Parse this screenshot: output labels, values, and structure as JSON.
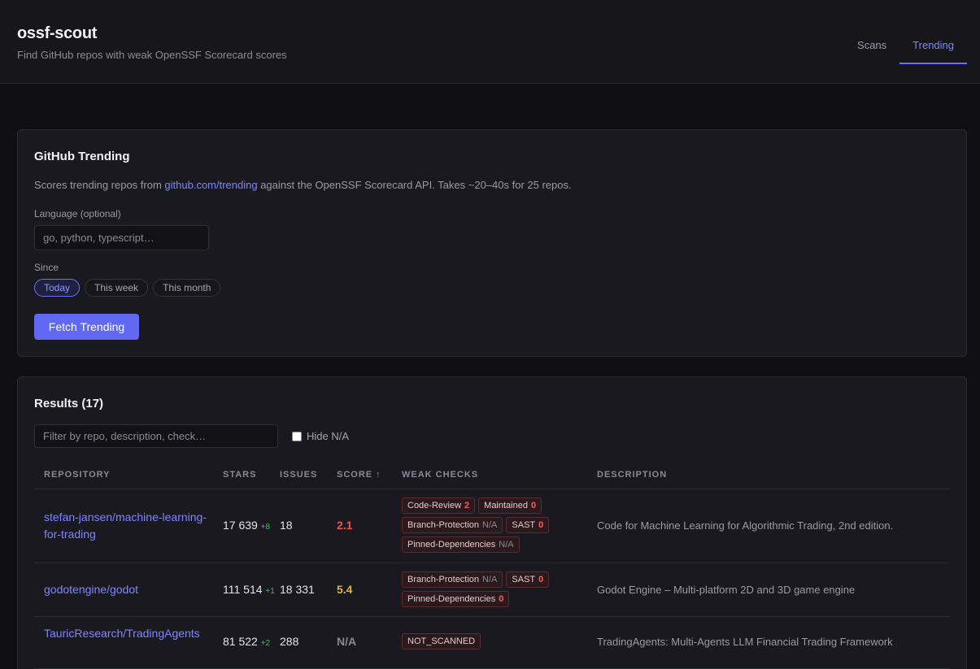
{
  "app": {
    "title": "ossf-scout",
    "subtitle": "Find GitHub repos with weak OpenSSF Scorecard scores"
  },
  "nav": {
    "tabs": [
      {
        "label": "Scans",
        "active": false
      },
      {
        "label": "Trending",
        "active": true
      }
    ]
  },
  "trending": {
    "title": "GitHub Trending",
    "desc_before": "Scores trending repos from ",
    "desc_link": "github.com/trending",
    "desc_after": " against the OpenSSF Scorecard API. Takes ~20–40s for 25 repos.",
    "language_label": "Language (optional)",
    "language_placeholder": "go, python, typescript…",
    "language_value": "",
    "since_label": "Since",
    "since_options": [
      "Today",
      "This week",
      "This month"
    ],
    "since_selected": "Today",
    "fetch_label": "Fetch Trending"
  },
  "results": {
    "title": "Results (17)",
    "filter_placeholder": "Filter by repo, description, check…",
    "hide_na_label": "Hide N/A",
    "hide_na_checked": false,
    "columns": {
      "repository": "REPOSITORY",
      "stars": "STARS",
      "issues": "ISSUES",
      "score": "SCORE ↑",
      "weak_checks": "WEAK CHECKS",
      "description": "DESCRIPTION"
    },
    "rows": [
      {
        "repo": "stefan-jansen/machine-learning-for-trading",
        "stars": "17 639",
        "stars_delta": "+8",
        "issues": "18",
        "score": "2.1",
        "score_color": "#f05252",
        "checks": [
          {
            "name": "Code-Review",
            "value": "2"
          },
          {
            "name": "Maintained",
            "value": "0"
          },
          {
            "name": "Branch-Protection",
            "value": "N/A"
          },
          {
            "name": "SAST",
            "value": "0"
          },
          {
            "name": "Pinned-Dependencies",
            "value": "N/A"
          }
        ],
        "description": "Code for Machine Learning for Algorithmic Trading, 2nd edition."
      },
      {
        "repo": "godotengine/godot",
        "stars": "111 514",
        "stars_delta": "+1",
        "issues": "18 331",
        "score": "5.4",
        "score_color": "#e3b341",
        "checks": [
          {
            "name": "Branch-Protection",
            "value": "N/A"
          },
          {
            "name": "SAST",
            "value": "0"
          },
          {
            "name": "Pinned-Dependencies",
            "value": "0"
          }
        ],
        "description": "Godot Engine – Multi-platform 2D and 3D game engine"
      },
      {
        "repo": "TauricResearch/TradingAgents",
        "stars": "81 522",
        "stars_delta": "+2",
        "issues": "288",
        "score": "N/A",
        "score_color": "#8a8a96",
        "checks": [
          {
            "name": "NOT_SCANNED",
            "value": ""
          }
        ],
        "description": "TradingAgents: Multi-Agents LLM Financial Trading Framework"
      }
    ]
  }
}
